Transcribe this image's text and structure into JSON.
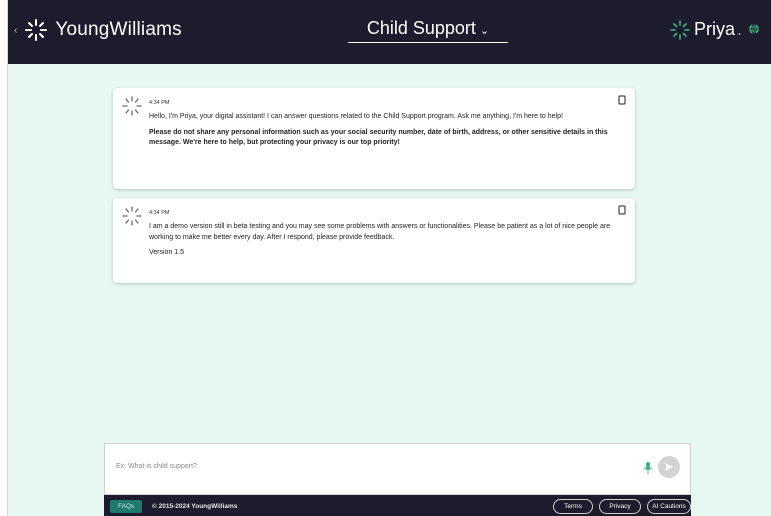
{
  "header": {
    "brand": "YoungWilliams",
    "title": "Child Support",
    "assistant_name": "Priya",
    "assistant_dot": "."
  },
  "messages": [
    {
      "time": "4:34 PM",
      "text": "Hello, I'm Priya, your digital assistant! I can answer questions related to the Child Support program. Ask me anything, I'm here to help!",
      "bold_text": "Please do not share any personal information such as your social security number, date of birth, address, or other sensitive details in this message. We're here to help, but protecting your privacy is our top priority!"
    },
    {
      "time": "4:34 PM",
      "text": "I am a demo version still in beta testing and you may see some problems with answers or functionalities. Please be patient as a lot of nice people are working to make me better every day. After I respond, please provide feedback.",
      "version": "Version 1.5"
    }
  ],
  "composer": {
    "placeholder": "Ex: What is child support?"
  },
  "footer": {
    "faqs": "FAQs",
    "copyright": "© 2015-2024 YoungWilliams",
    "terms": "Terms",
    "privacy": "Privacy",
    "ai_cautions": "AI Cautions"
  },
  "colors": {
    "header_bg": "#1c1c2c",
    "page_bg": "#e6f8f1",
    "accent_teal": "#1f7a6c",
    "logo_green": "#3fb37f"
  }
}
